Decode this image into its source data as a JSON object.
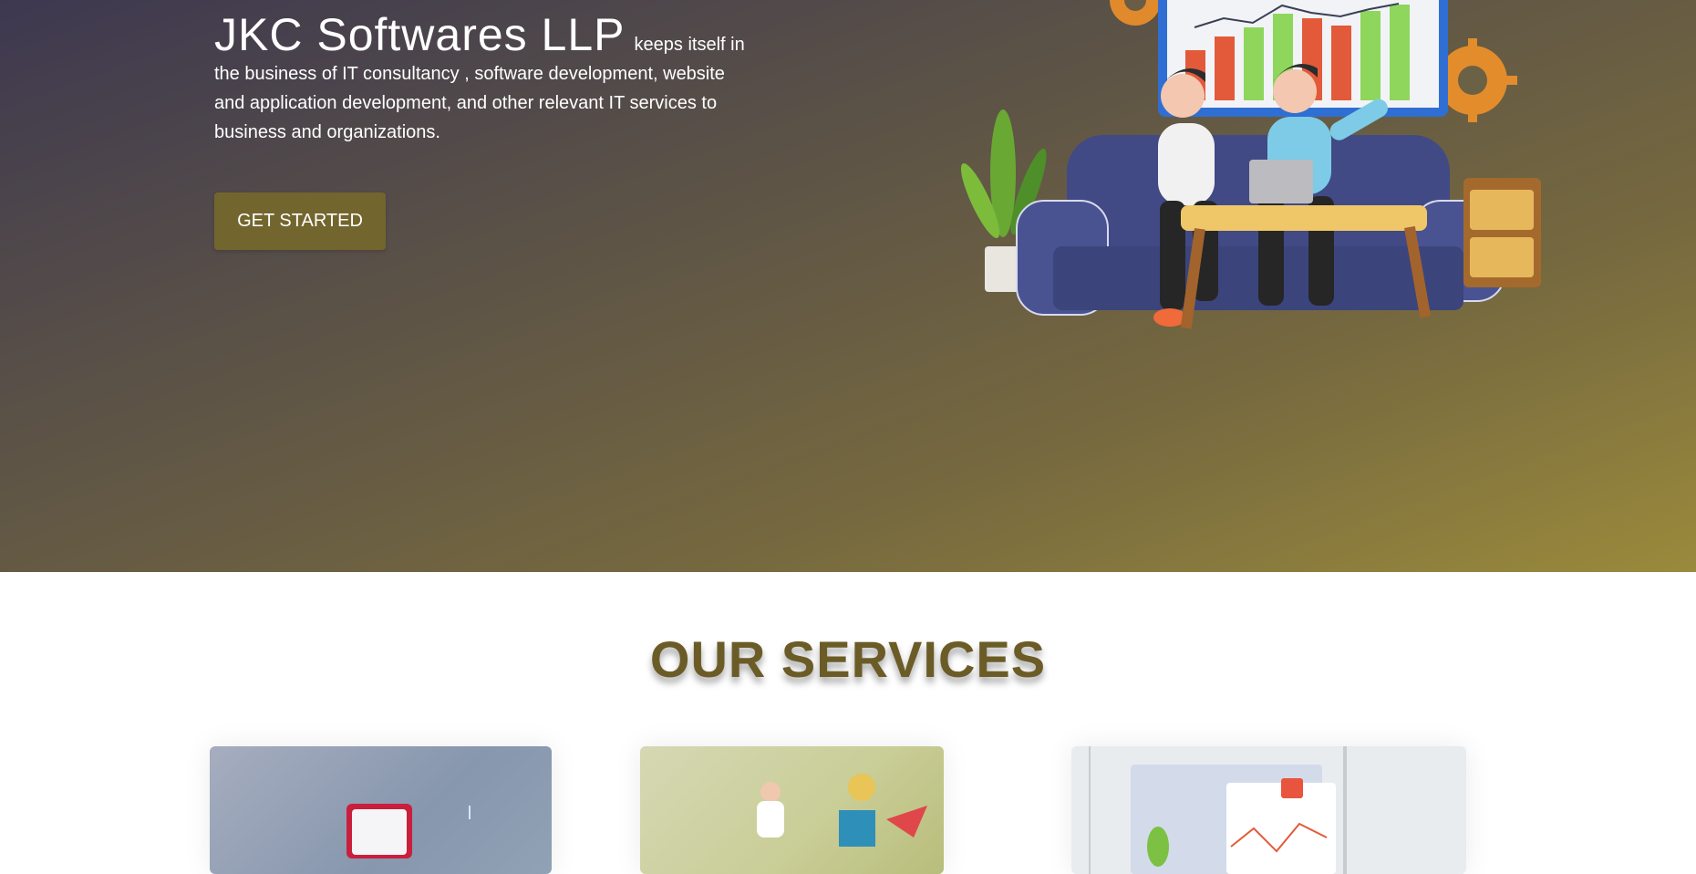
{
  "hero": {
    "brand_name": "JKC Softwares LLP",
    "tagline_line1": "keeps itself in",
    "tagline_line2": "the business of IT consultancy , software development, website",
    "tagline_line3": "and application development, and other relevant IT services to",
    "tagline_line4": "business and organizations.",
    "cta_label": "GET STARTED",
    "illustration": "team-working-on-sofa-illustration"
  },
  "services": {
    "title": "OUR SERVICES",
    "cards": [
      {
        "image": "service-image-1"
      },
      {
        "image": "service-image-2"
      },
      {
        "image": "service-image-3"
      }
    ]
  },
  "colors": {
    "accent": "#72662e",
    "title": "#6b5c27",
    "hero_start": "#3d3850",
    "hero_end": "#9a8a3c"
  }
}
